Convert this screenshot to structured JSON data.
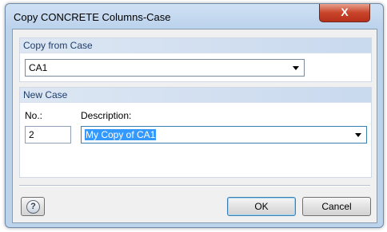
{
  "window": {
    "title": "Copy CONCRETE Columns-Case",
    "close_label": "X"
  },
  "copy_from": {
    "heading": "Copy from Case",
    "selected": "CA1"
  },
  "new_case": {
    "heading": "New Case",
    "no_label": "No.:",
    "no_value": "2",
    "description_label": "Description:",
    "description_value": "My Copy of CA1"
  },
  "buttons": {
    "help_icon": "?",
    "ok": "OK",
    "cancel": "Cancel"
  },
  "colors": {
    "selection": "#3399ff",
    "group_heading": "#1e3d6b"
  }
}
